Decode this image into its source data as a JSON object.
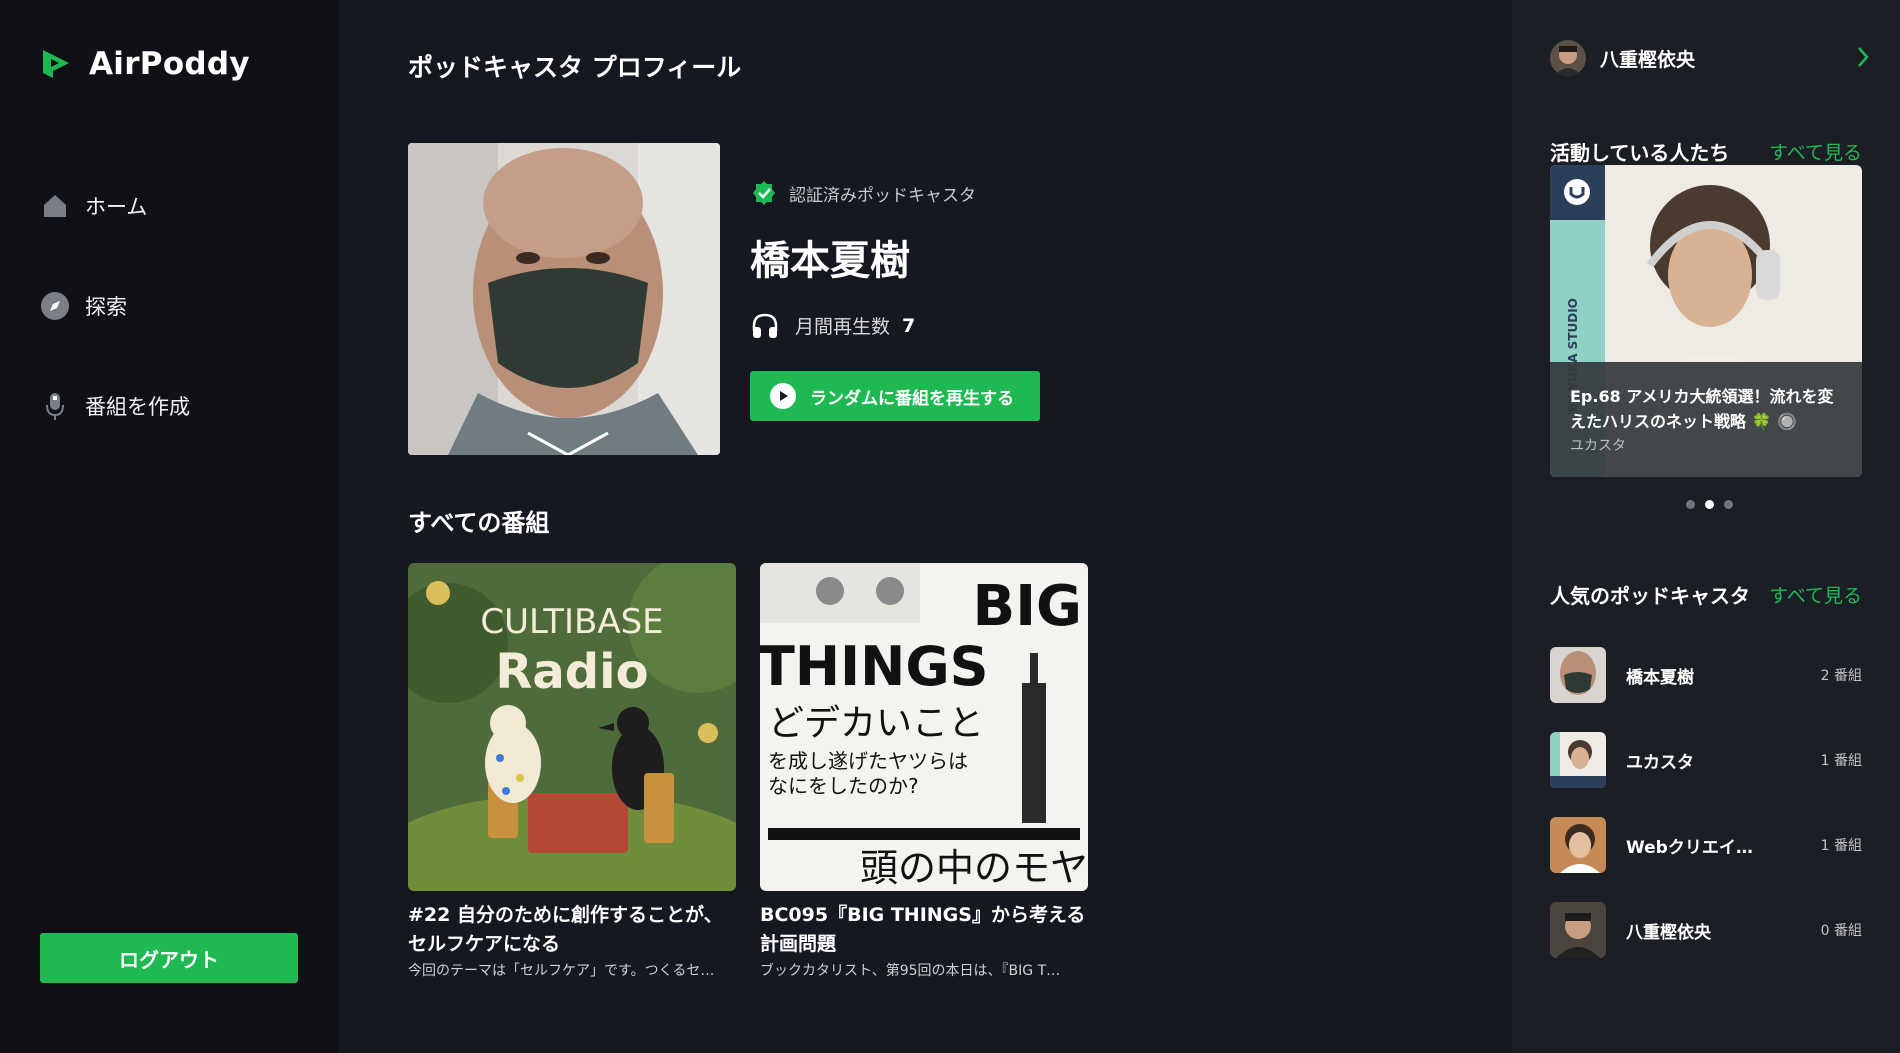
{
  "brand": {
    "name": "AirPoddy",
    "logo_icon": "airpoddy-logo-icon",
    "accent": "#1fb954"
  },
  "nav": [
    {
      "label": "ホーム",
      "icon": "home-icon"
    },
    {
      "label": "探索",
      "icon": "compass-icon"
    },
    {
      "label": "番組を作成",
      "icon": "microphone-icon"
    }
  ],
  "logout_label": "ログアウト",
  "main": {
    "page_title": "ポッドキャスタ プロフィール",
    "profile": {
      "verified_label": "認証済みポッドキャスタ",
      "name": "橋本夏樹",
      "monthly_plays_label": "月間再生数",
      "monthly_plays": "7",
      "random_button_label": "ランダムに番組を再生する"
    },
    "programs_section_title": "すべての番組",
    "programs": [
      {
        "title": "#22 自分のために創作することが、セルフケアになる",
        "description": "今回のテーマは「セルフケア」です。つくるセ…",
        "cover_text_line1": "CULTIBASE",
        "cover_text_line2": "Radio"
      },
      {
        "title": "BC095『BIG THINGS』から考える計画問題",
        "description": "ブックカタリスト、第95回の本日は、『BIG T…",
        "cover_text_line1": "BIG",
        "cover_text_line2": "THINGS",
        "cover_text_line3": "どデカいこと",
        "cover_text_line4": "を成し遂げたヤツらは",
        "cover_text_line5": "なにをしたのか?",
        "cover_text_line6": "頭の中のモヤ"
      }
    ]
  },
  "right": {
    "user_name": "八重樫依央",
    "active_title": "活動している人たち",
    "see_all_label": "すべて見る",
    "active_card": {
      "episode_title": "Ep.68 アメリカ大統領選！流れを変えたハリスのネット戦略 🍀 🔘",
      "podcast": "ユカスタ",
      "vertical_text": "BY YUKA STUDIO"
    },
    "carousel_active_index": 1,
    "popular_title": "人気のポッドキャスタ",
    "popular": [
      {
        "name": "橋本夏樹",
        "count": "2 番組"
      },
      {
        "name": "ユカスタ",
        "count": "1 番組"
      },
      {
        "name": "Webクリエイ…",
        "count": "1 番組"
      },
      {
        "name": "八重樫依央",
        "count": "0 番組"
      }
    ]
  }
}
